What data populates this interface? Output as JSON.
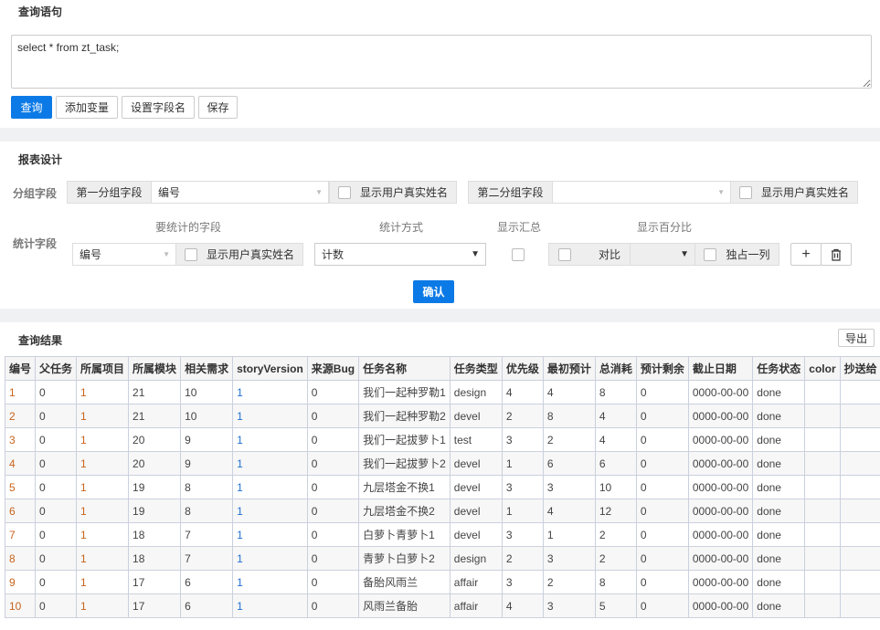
{
  "query": {
    "title": "查询语句",
    "sql": "select * from zt_task;",
    "buttons": [
      "查询",
      "添加变量",
      "设置字段名",
      "保存"
    ]
  },
  "design": {
    "title": "报表设计",
    "group_label": "分组字段",
    "first_group": "第一分组字段",
    "first_value": "编号",
    "show_real_name": "显示用户真实姓名",
    "second_group": "第二分组字段",
    "second_value": "",
    "stat_label": "统计字段",
    "col_field": "要统计的字段",
    "col_method": "统计方式",
    "col_total": "显示汇总",
    "col_percent": "显示百分比",
    "stat_field_value": "编号",
    "stat_method_value": "计数",
    "compare": "对比",
    "own_column": "独占一列",
    "add": "+",
    "confirm": "确认"
  },
  "result": {
    "title": "查询结果",
    "export": "导出",
    "columns": [
      "编号",
      "父任务",
      "所属项目",
      "所属模块",
      "相关需求",
      "storyVersion",
      "来源Bug",
      "任务名称",
      "任务类型",
      "优先级",
      "最初预计",
      "总消耗",
      "预计剩余",
      "截止日期",
      "任务状态",
      "color",
      "抄送给"
    ],
    "rows": [
      [
        "1",
        "0",
        "1",
        "21",
        "10",
        "1",
        "0",
        "我们一起种罗勒1",
        "design",
        "4",
        "4",
        "8",
        "0",
        "0000-00-00",
        "done",
        "",
        ""
      ],
      [
        "2",
        "0",
        "1",
        "21",
        "10",
        "1",
        "0",
        "我们一起种罗勒2",
        "devel",
        "2",
        "8",
        "4",
        "0",
        "0000-00-00",
        "done",
        "",
        ""
      ],
      [
        "3",
        "0",
        "1",
        "20",
        "9",
        "1",
        "0",
        "我们一起拔萝卜1",
        "test",
        "3",
        "2",
        "4",
        "0",
        "0000-00-00",
        "done",
        "",
        ""
      ],
      [
        "4",
        "0",
        "1",
        "20",
        "9",
        "1",
        "0",
        "我们一起拔萝卜2",
        "devel",
        "1",
        "6",
        "6",
        "0",
        "0000-00-00",
        "done",
        "",
        ""
      ],
      [
        "5",
        "0",
        "1",
        "19",
        "8",
        "1",
        "0",
        "九层塔金不换1",
        "devel",
        "3",
        "3",
        "10",
        "0",
        "0000-00-00",
        "done",
        "",
        ""
      ],
      [
        "6",
        "0",
        "1",
        "19",
        "8",
        "1",
        "0",
        "九层塔金不换2",
        "devel",
        "1",
        "4",
        "12",
        "0",
        "0000-00-00",
        "done",
        "",
        ""
      ],
      [
        "7",
        "0",
        "1",
        "18",
        "7",
        "1",
        "0",
        "白萝卜青萝卜1",
        "devel",
        "3",
        "1",
        "2",
        "0",
        "0000-00-00",
        "done",
        "",
        ""
      ],
      [
        "8",
        "0",
        "1",
        "18",
        "7",
        "1",
        "0",
        "青萝卜白萝卜2",
        "design",
        "2",
        "3",
        "2",
        "0",
        "0000-00-00",
        "done",
        "",
        ""
      ],
      [
        "9",
        "0",
        "1",
        "17",
        "6",
        "1",
        "0",
        "备胎风雨兰",
        "affair",
        "3",
        "2",
        "8",
        "0",
        "0000-00-00",
        "done",
        "",
        ""
      ],
      [
        "10",
        "0",
        "1",
        "17",
        "6",
        "1",
        "0",
        "风雨兰备胎",
        "affair",
        "4",
        "3",
        "5",
        "0",
        "0000-00-00",
        "done",
        "",
        ""
      ]
    ]
  },
  "colors": {
    "primary": "#0c7ae6",
    "orange": "#c8641e",
    "blue": "#1f6fd1"
  }
}
